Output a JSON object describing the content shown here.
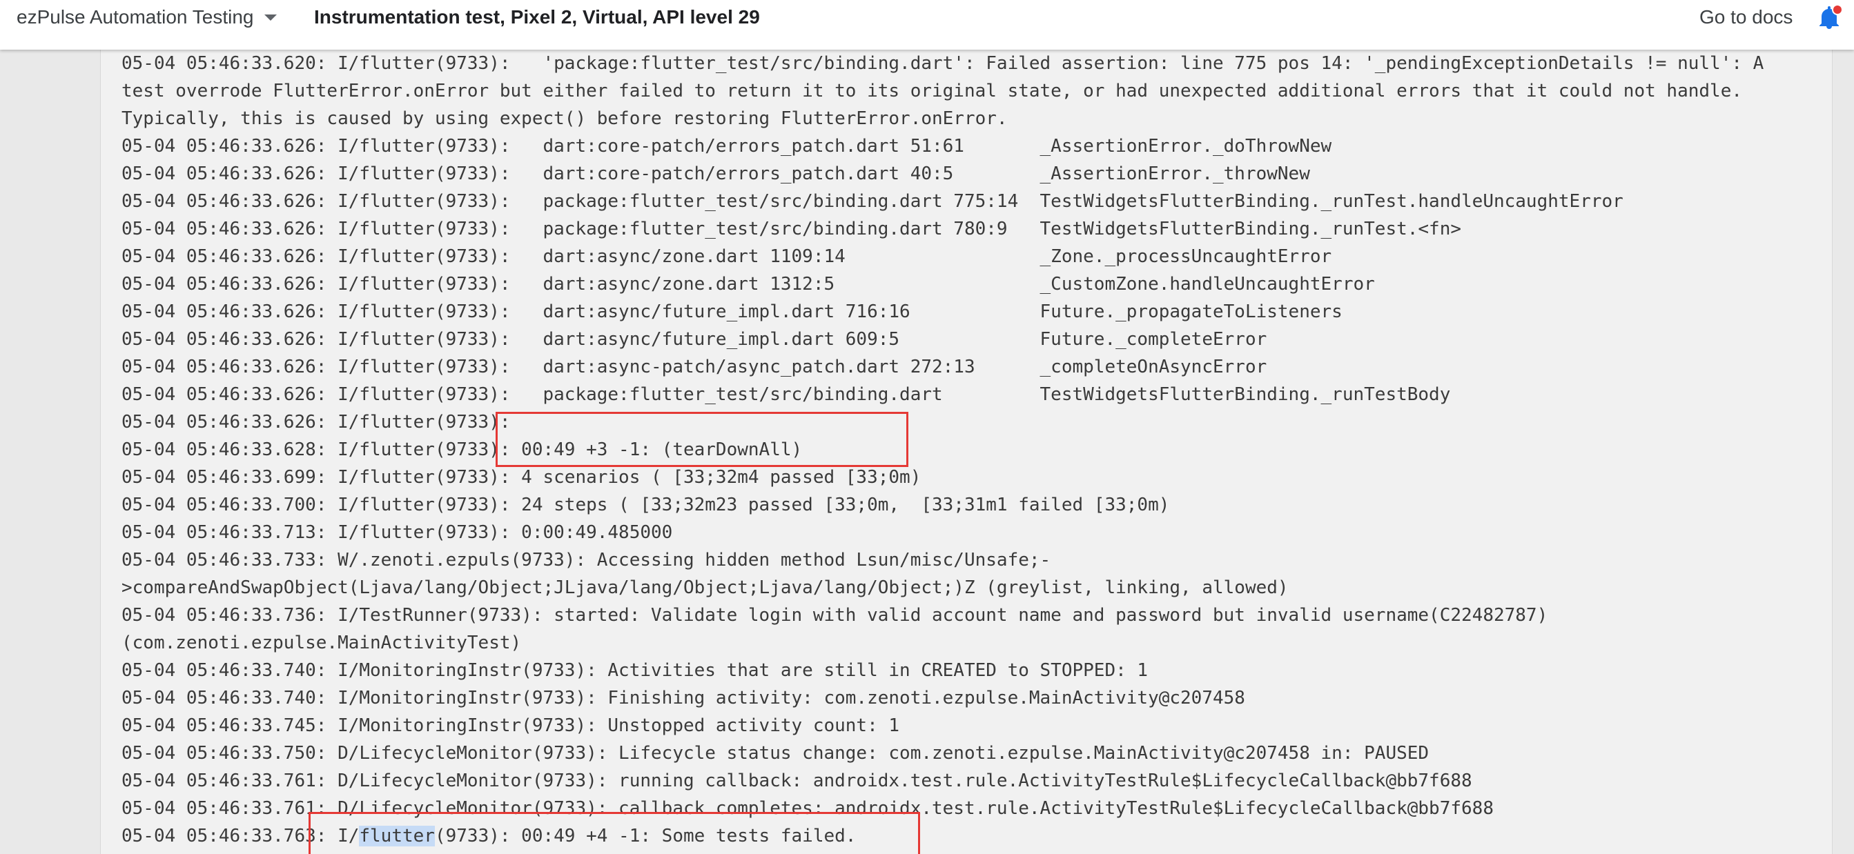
{
  "header": {
    "project_name": "ezPulse Automation Testing",
    "run_title": "Instrumentation test, Pixel 2, Virtual, API level 29",
    "docs_link": "Go to docs"
  },
  "log_lines": [
    "05-04 05:46:33.620: I/flutter(9733):   'package:flutter_test/src/binding.dart': Failed assertion: line 775 pos 14: '_pendingExceptionDetails != null': A",
    "test overrode FlutterError.onError but either failed to return it to its original state, or had unexpected additional errors that it could not handle.",
    "Typically, this is caused by using expect() before restoring FlutterError.onError.",
    "05-04 05:46:33.626: I/flutter(9733):   dart:core-patch/errors_patch.dart 51:61       _AssertionError._doThrowNew",
    "05-04 05:46:33.626: I/flutter(9733):   dart:core-patch/errors_patch.dart 40:5        _AssertionError._throwNew",
    "05-04 05:46:33.626: I/flutter(9733):   package:flutter_test/src/binding.dart 775:14  TestWidgetsFlutterBinding._runTest.handleUncaughtError",
    "05-04 05:46:33.626: I/flutter(9733):   package:flutter_test/src/binding.dart 780:9   TestWidgetsFlutterBinding._runTest.<fn>",
    "05-04 05:46:33.626: I/flutter(9733):   dart:async/zone.dart 1109:14                  _Zone._processUncaughtError",
    "05-04 05:46:33.626: I/flutter(9733):   dart:async/zone.dart 1312:5                   _CustomZone.handleUncaughtError",
    "05-04 05:46:33.626: I/flutter(9733):   dart:async/future_impl.dart 716:16            Future._propagateToListeners",
    "05-04 05:46:33.626: I/flutter(9733):   dart:async/future_impl.dart 609:5             Future._completeError",
    "05-04 05:46:33.626: I/flutter(9733):   dart:async-patch/async_patch.dart 272:13      _completeOnAsyncError",
    "05-04 05:46:33.626: I/flutter(9733):   package:flutter_test/src/binding.dart         TestWidgetsFlutterBinding._runTestBody",
    "05-04 05:46:33.626: I/flutter(9733):",
    "05-04 05:46:33.628: I/flutter(9733): 00:49 +3 -1: (tearDownAll)",
    "05-04 05:46:33.699: I/flutter(9733): 4 scenarios ( [33;32m4 passed [33;0m)",
    "05-04 05:46:33.700: I/flutter(9733): 24 steps ( [33;32m23 passed [33;0m,  [33;31m1 failed [33;0m)",
    "05-04 05:46:33.713: I/flutter(9733): 0:00:49.485000",
    "05-04 05:46:33.733: W/.zenoti.ezpuls(9733): Accessing hidden method Lsun/misc/Unsafe;-",
    ">compareAndSwapObject(Ljava/lang/Object;JLjava/lang/Object;Ljava/lang/Object;)Z (greylist, linking, allowed)",
    "05-04 05:46:33.736: I/TestRunner(9733): started: Validate login with valid account name and password but invalid username(C22482787)",
    "(com.zenoti.ezpulse.MainActivityTest)",
    "05-04 05:46:33.740: I/MonitoringInstr(9733): Activities that are still in CREATED to STOPPED: 1",
    "05-04 05:46:33.740: I/MonitoringInstr(9733): Finishing activity: com.zenoti.ezpulse.MainActivity@c207458",
    "05-04 05:46:33.745: I/MonitoringInstr(9733): Unstopped activity count: 1",
    "05-04 05:46:33.750: D/LifecycleMonitor(9733): Lifecycle status change: com.zenoti.ezpulse.MainActivity@c207458 in: PAUSED",
    "05-04 05:46:33.761: D/LifecycleMonitor(9733): running callback: androidx.test.rule.ActivityTestRule$LifecycleCallback@bb7f688",
    "05-04 05:46:33.761: D/LifecycleMonitor(9733): callback completes: androidx.test.rule.ActivityTestRule$LifecycleCallback@bb7f688"
  ],
  "last_line": {
    "prefix": "05-04 05:46:33.763: I/",
    "selected": "flutter",
    "suffix": "(9733): 00:49 +4 -1: Some tests failed."
  },
  "colors": {
    "highlight_box": "#e53935",
    "selection": "#c6dbf6",
    "notification_dot": "#e53935"
  },
  "icons": {
    "dropdown": "caret-down-icon",
    "notifications": "bell-icon"
  }
}
